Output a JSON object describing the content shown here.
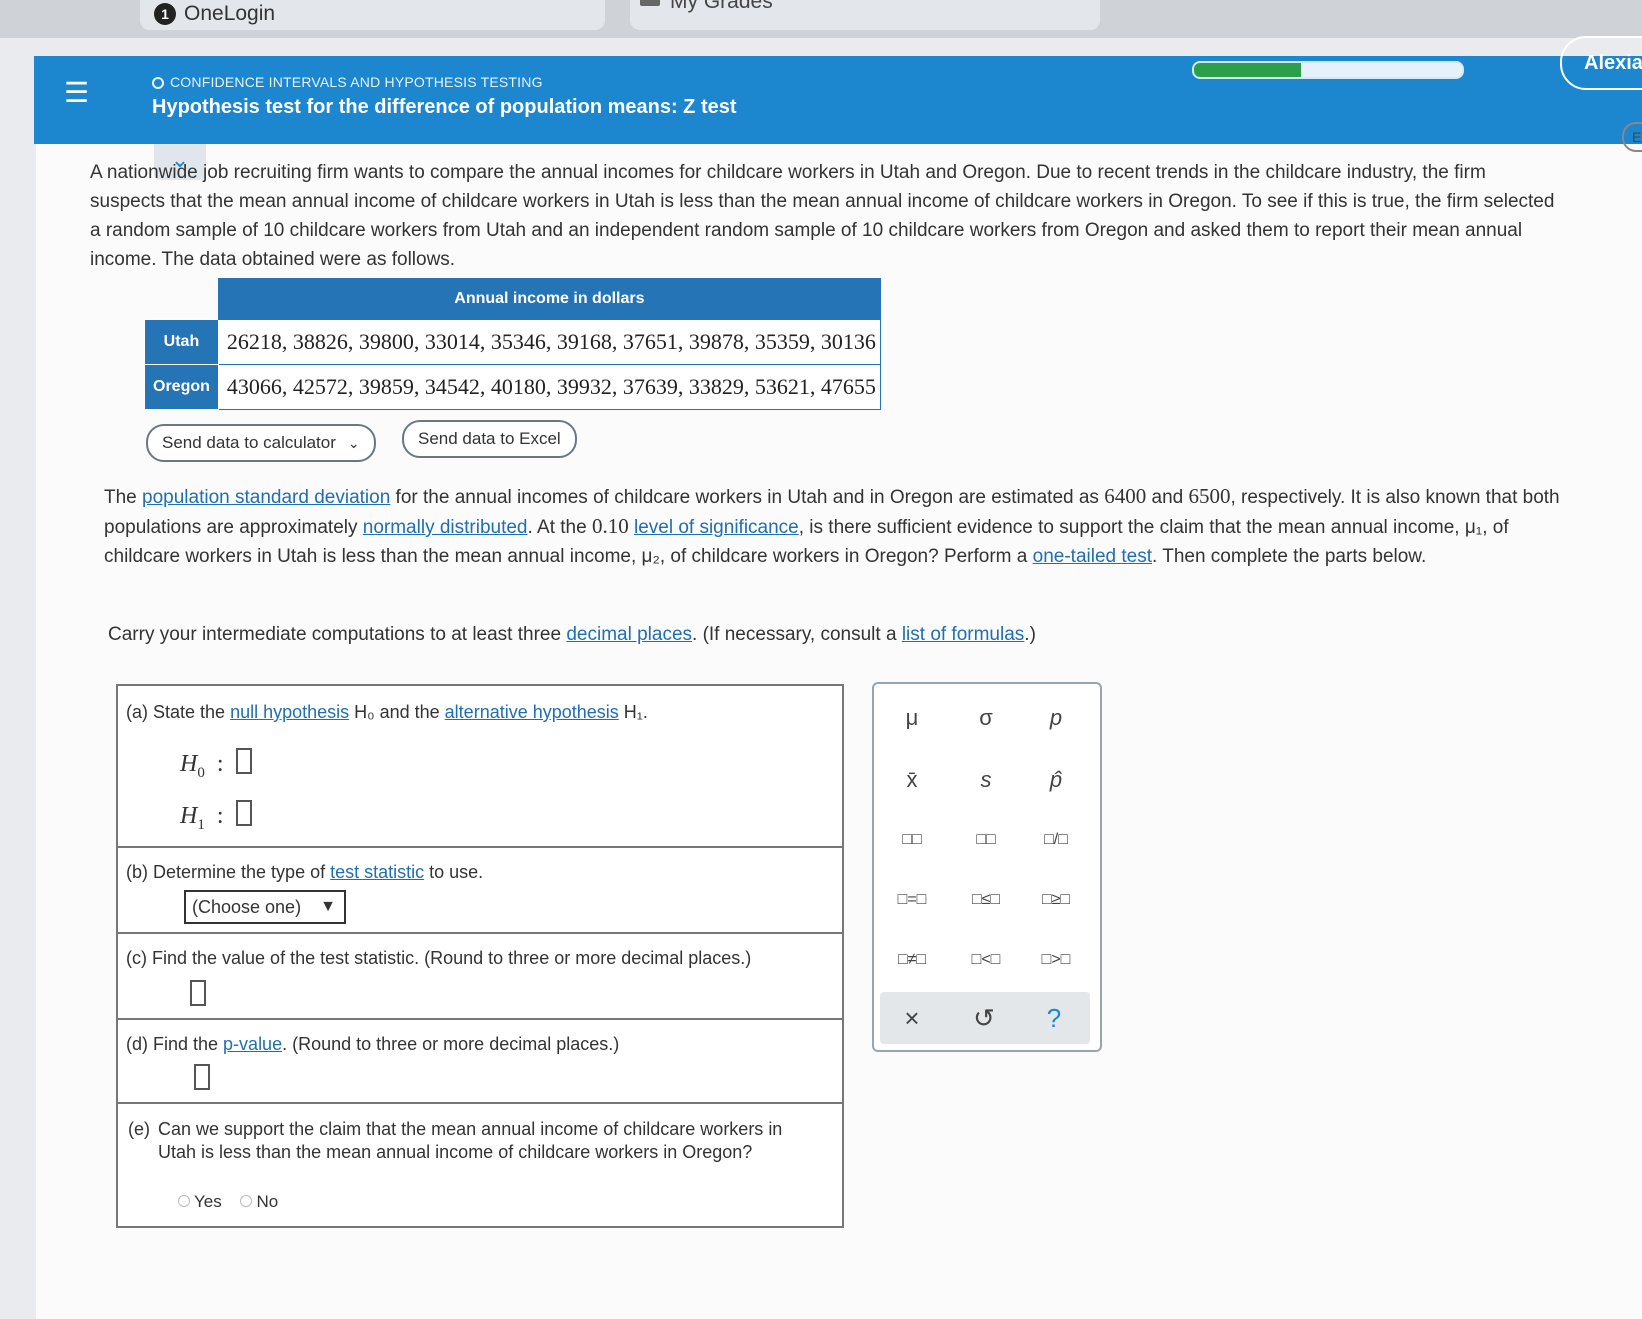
{
  "browser": {
    "tab1": {
      "badge": "1",
      "title": "OneLogin"
    },
    "tab2": {
      "title": "My Grades"
    }
  },
  "header": {
    "topic": "CONFIDENCE INTERVALS AND HYPOTHESIS TESTING",
    "title": "Hypothesis test for the difference of population means: Z test",
    "user": "Alexia",
    "progress_complete_fraction": 0.4,
    "menu_icon": "hamburger-icon"
  },
  "side_button": {
    "label": "Es"
  },
  "problem": {
    "intro": "A nationwide job recruiting firm wants to compare the annual incomes for childcare workers in Utah and Oregon. Due to recent trends in the childcare industry, the firm suspects that the mean annual income of childcare workers in Utah is less than the mean annual income of childcare workers in Oregon. To see if this is true, the firm selected a random sample of 10 childcare workers from Utah and an independent random sample of 10 childcare workers from Oregon and asked them to report their mean annual income. The data obtained were as follows.",
    "table": {
      "header": "Annual income in dollars",
      "rows": [
        {
          "label": "Utah",
          "values": "26218, 38826, 39800, 33014, 35346, 39168, 37651, 39878, 35359, 30136"
        },
        {
          "label": "Oregon",
          "values": "43066, 42572, 39859, 34542, 40180, 39932, 37639, 33829, 53621, 47655"
        }
      ]
    },
    "buttons": {
      "calculator": "Send data to calculator",
      "excel": "Send data to Excel"
    },
    "para2": {
      "t1": "The ",
      "l1": "population standard deviation",
      "t2": " for the annual incomes of childcare workers in Utah and in Oregon are estimated as ",
      "n1": "6400",
      "t3": " and ",
      "n2": "6500",
      "t4": ", respectively. It is also known that both populations are approximately ",
      "l2": "normally distributed",
      "t5": ". At the ",
      "n3": "0.10",
      "t6": " ",
      "l3": "level of significance",
      "t7": ", is there sufficient evidence to support the claim that the mean annual income, μ₁, of childcare workers in Utah is less than the mean annual income, μ₂, of childcare workers in Oregon? Perform a ",
      "l4": "one-tailed test",
      "t8": ". Then complete the parts below."
    },
    "para3": {
      "t1": "Carry your intermediate computations to at least three ",
      "l1": "decimal places",
      "t2": ". (If necessary, consult a ",
      "l2": "list of formulas",
      "t3": ".)"
    }
  },
  "parts": {
    "a": {
      "t1": "(a)  State the ",
      "l1": "null hypothesis",
      "t2": " H₀ and the ",
      "l2": "alternative hypothesis",
      "t3": " H₁.",
      "h0": "H",
      "h0sub": "0",
      "h1": "H",
      "h1sub": "1"
    },
    "b": {
      "t1": "(b)  Determine the type of ",
      "l1": "test statistic",
      "t2": " to use.",
      "select": "(Choose one)"
    },
    "c": {
      "text": "(c)  Find the value of the test statistic. (Round to three or more decimal places.)"
    },
    "d": {
      "t1": "(d)  Find the ",
      "l1": "p-value",
      "t2": ". (Round to three or more decimal places.)"
    },
    "e": {
      "letter": "(e)",
      "text": "Can we support the claim that the mean annual income of childcare workers in Utah is less than the mean annual income of childcare workers in Oregon?",
      "yes": "Yes",
      "no": "No"
    }
  },
  "palette": {
    "row1": [
      "μ",
      "σ",
      "p"
    ],
    "row2": [
      "x̄",
      "s",
      "p̂"
    ],
    "row3": [
      "□□",
      "□□",
      "□/□"
    ],
    "row4": [
      "□=□",
      "□≤□",
      "□≥□"
    ],
    "row5": [
      "□≠□",
      "□<□",
      "□>□"
    ],
    "foot": [
      "×",
      "↺",
      "?"
    ]
  },
  "colors": {
    "header": "#1c86cf",
    "table_head": "#2574b6",
    "link": "#1f6fb0",
    "progress_fill": "#2aa04a"
  }
}
